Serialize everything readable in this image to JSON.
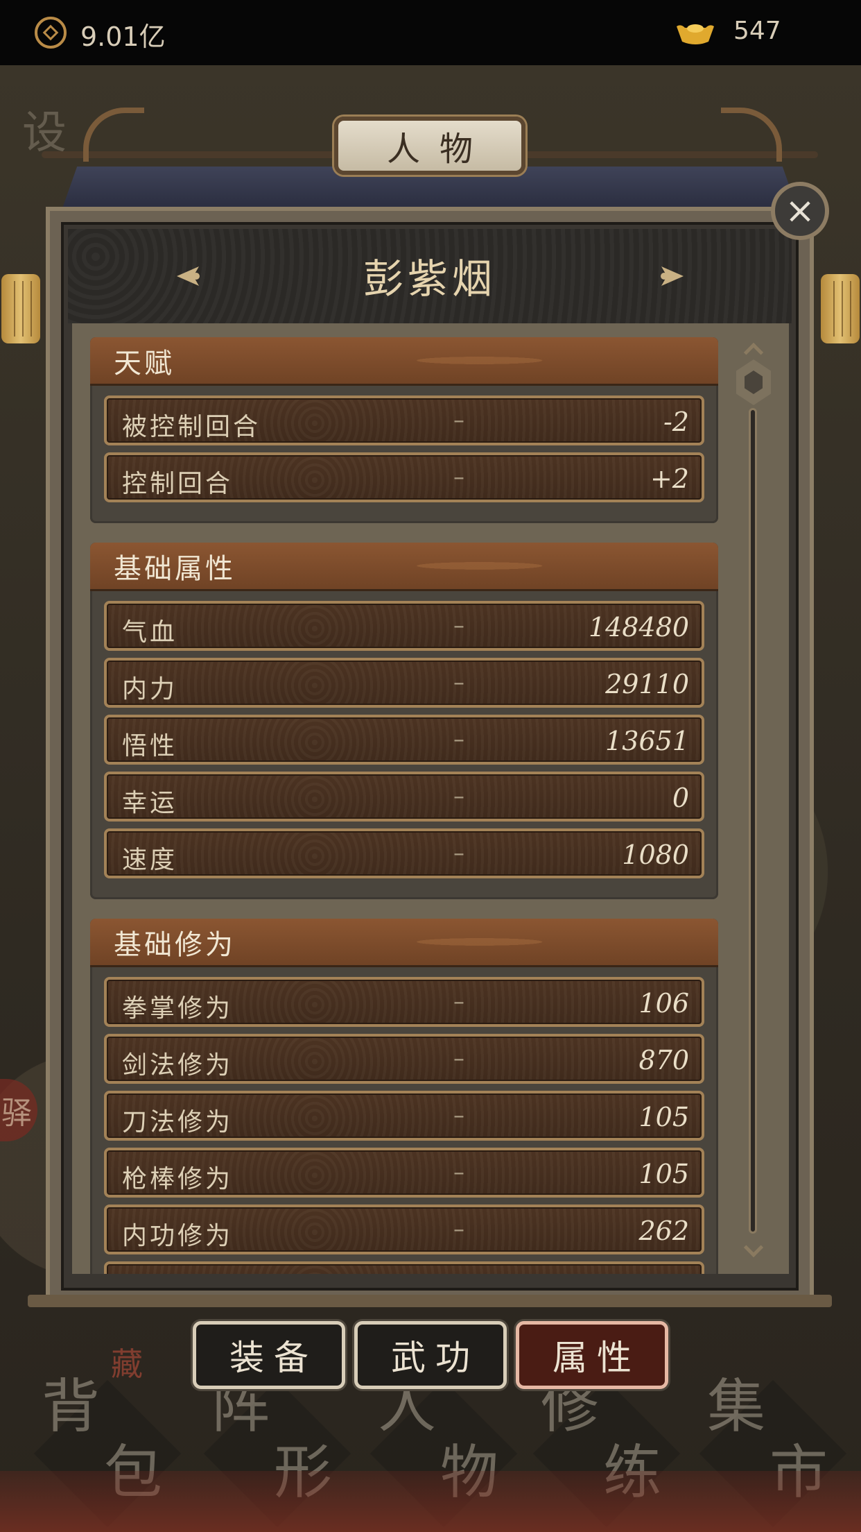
{
  "status_bar": {
    "coin_value": "9.01亿",
    "ingot_value": "547"
  },
  "background": {
    "map_chars": [
      "设",
      "驿"
    ],
    "bottom_nav": [
      {
        "c1": "背",
        "c2": "包"
      },
      {
        "c1": "阵",
        "c2": "形"
      },
      {
        "c1": "人",
        "c2": "物"
      },
      {
        "c1": "修",
        "c2": "练"
      },
      {
        "c1": "集",
        "c2": "市"
      }
    ],
    "storage_label": "藏"
  },
  "panel": {
    "title": "人物",
    "character_name": "彭紫烟",
    "close_icon": "close-icon"
  },
  "sections": [
    {
      "title": "天赋",
      "rows": [
        {
          "label": "被控制回合",
          "dash": "–",
          "value": "-2"
        },
        {
          "label": "控制回合",
          "dash": "–",
          "value": "+2"
        }
      ]
    },
    {
      "title": "基础属性",
      "rows": [
        {
          "label": "气血",
          "dash": "–",
          "value": "148480"
        },
        {
          "label": "内力",
          "dash": "–",
          "value": "29110"
        },
        {
          "label": "悟性",
          "dash": "–",
          "value": "13651"
        },
        {
          "label": "幸运",
          "dash": "–",
          "value": "0"
        },
        {
          "label": "速度",
          "dash": "–",
          "value": "1080"
        }
      ]
    },
    {
      "title": "基础修为",
      "rows": [
        {
          "label": "拳掌修为",
          "dash": "–",
          "value": "106"
        },
        {
          "label": "剑法修为",
          "dash": "–",
          "value": "870"
        },
        {
          "label": "刀法修为",
          "dash": "–",
          "value": "105"
        },
        {
          "label": "枪棒修为",
          "dash": "–",
          "value": "105"
        },
        {
          "label": "内功修为",
          "dash": "–",
          "value": "262"
        }
      ]
    }
  ],
  "tabs": [
    {
      "label": "装备",
      "active": false
    },
    {
      "label": "武功",
      "active": false
    },
    {
      "label": "属性",
      "active": true
    }
  ],
  "colors": {
    "accent_brown": "#8b5632",
    "active_tab": "#4a1c14",
    "gold": "#b98b47"
  }
}
